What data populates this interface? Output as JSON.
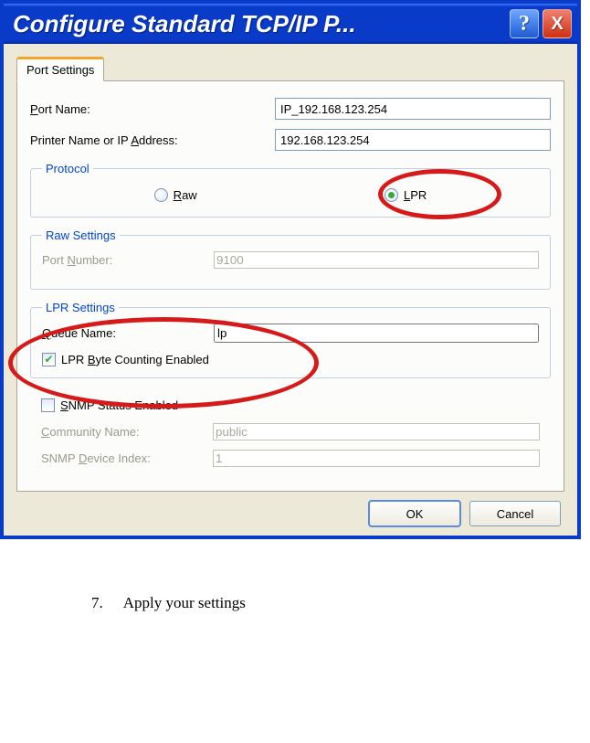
{
  "window": {
    "title": "Configure Standard TCP/IP P...",
    "help_tooltip": "?",
    "close_tooltip": "X"
  },
  "tab": {
    "label": "Port Settings"
  },
  "fields": {
    "port_name_label": "Port Name:",
    "port_name_value": "IP_192.168.123.254",
    "ip_label": "Printer Name or IP Address:",
    "ip_value": "192.168.123.254"
  },
  "protocol": {
    "legend": "Protocol",
    "raw_label": "Raw",
    "lpr_label": "LPR",
    "selected": "lpr"
  },
  "raw_settings": {
    "legend": "Raw Settings",
    "port_number_label": "Port Number:",
    "port_number_value": "9100"
  },
  "lpr_settings": {
    "legend": "LPR Settings",
    "queue_label": "Queue Name:",
    "queue_value": "lp",
    "byte_counting_label": "LPR Byte Counting Enabled",
    "byte_counting_checked": true
  },
  "snmp": {
    "status_label": "SNMP Status Enabled",
    "status_checked": false,
    "community_label": "Community Name:",
    "community_value": "public",
    "index_label": "SNMP Device Index:",
    "index_value": "1"
  },
  "buttons": {
    "ok": "OK",
    "cancel": "Cancel"
  },
  "doc": {
    "step_num": "7.",
    "step_text": "Apply your settings"
  }
}
